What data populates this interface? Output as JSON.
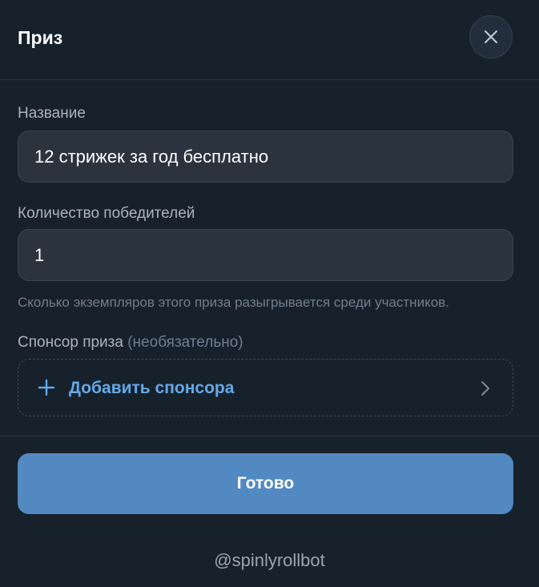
{
  "header": {
    "title": "Приз",
    "close_icon": "close-icon"
  },
  "form": {
    "name_label": "Название",
    "name_value": "12 стрижек за год бесплатно",
    "count_label": "Количество победителей",
    "count_value": "1",
    "count_hint": "Сколько экземпляров этого приза разыгрывается среди участников.",
    "sponsor_label": "Спонсор приза",
    "sponsor_optional": "(необязательно)",
    "add_sponsor_label": "Добавить спонсора",
    "add_sponsor_icon": "plus-icon",
    "add_sponsor_chevron": "chevron-right-icon"
  },
  "actions": {
    "done_label": "Готово"
  },
  "footer": {
    "bot_handle": "@spinlyrollbot"
  },
  "colors": {
    "background": "#17212b",
    "input_background": "#2b333e",
    "accent_link": "#64a9e9",
    "primary_button": "#5289c1",
    "muted_text": "#6f7f8f"
  }
}
